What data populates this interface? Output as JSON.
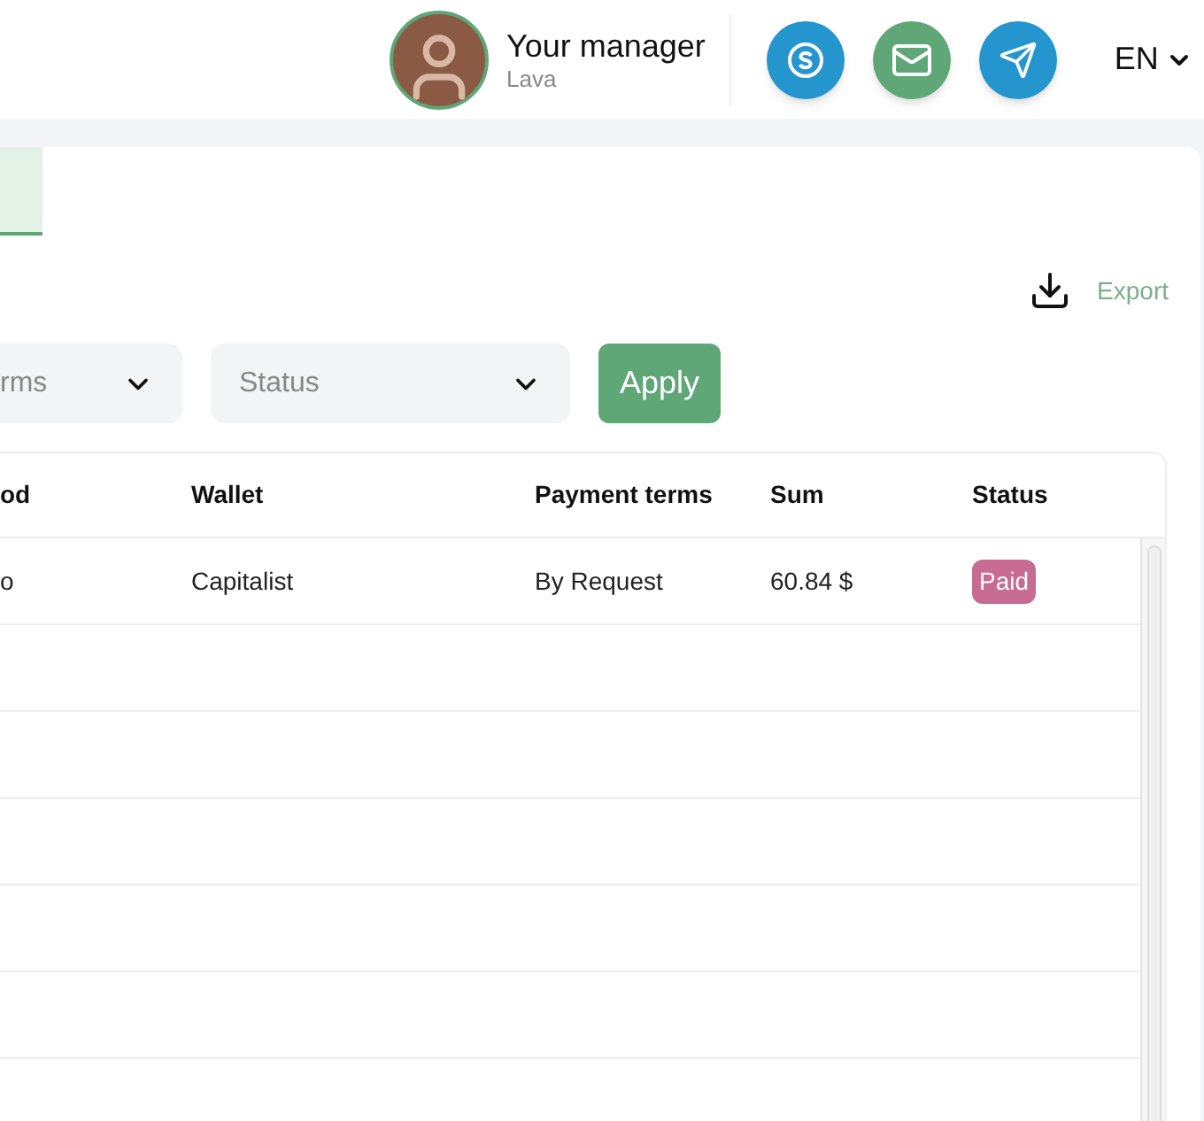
{
  "header": {
    "manager": {
      "title": "Your manager",
      "name": "Lava"
    },
    "contacts": [
      {
        "kind": "skype",
        "color": "#2596cd"
      },
      {
        "kind": "mail",
        "color": "#5fa777"
      },
      {
        "kind": "telegram",
        "color": "#2596cd"
      }
    ],
    "language": "EN"
  },
  "tab": {
    "selected": true
  },
  "export": {
    "label": "Export"
  },
  "filters": [
    {
      "placeholder": "rms"
    },
    {
      "placeholder": "Status"
    }
  ],
  "apply": {
    "label": "Apply"
  },
  "table": {
    "columns": [
      "od",
      "Wallet",
      "Payment terms",
      "Sum",
      "Status"
    ],
    "rows": [
      {
        "column_1": "o",
        "wallet": "Capitalist",
        "payment_terms": "By Request",
        "sum": "60.84 $",
        "status": {
          "text": "Paid",
          "color": "#c76b92"
        }
      }
    ]
  }
}
